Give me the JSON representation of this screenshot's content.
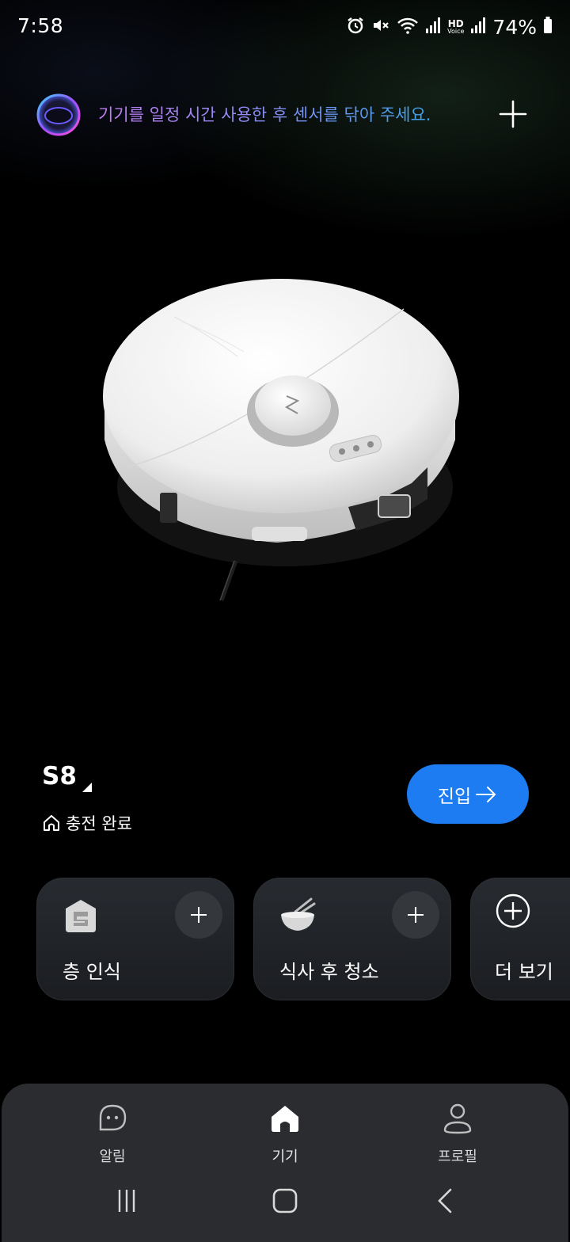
{
  "status_bar": {
    "time": "7:58",
    "battery": "74%",
    "icons": [
      "alarm-icon",
      "mute-icon",
      "wifi-icon",
      "signal-icon",
      "hd-voice-icon",
      "signal-icon",
      "battery-icon"
    ],
    "hd_top": "HD",
    "hd_bottom": "Voice"
  },
  "banner": {
    "message": "기기를 일정 시간 사용한 후 센서를 닦아 주세요.",
    "gradient_colors": [
      "#c27cf2",
      "#8f8bf7",
      "#3fa4ec"
    ]
  },
  "device": {
    "name": "S8",
    "status": "충전 완료",
    "enter_label": "진입",
    "accent": "#1d7cf2"
  },
  "cards": [
    {
      "label": "층 인식",
      "icon": "floor-recognition-icon"
    },
    {
      "label": "식사 후 청소",
      "icon": "meal-bowl-icon"
    },
    {
      "label": "더 보기",
      "icon": "plus-circle-icon"
    }
  ],
  "bottom_nav": {
    "items": [
      {
        "label": "알림",
        "icon": "chat-bubble-icon",
        "active": false
      },
      {
        "label": "기기",
        "icon": "home-icon",
        "active": true
      },
      {
        "label": "프로필",
        "icon": "person-icon",
        "active": false
      }
    ]
  }
}
